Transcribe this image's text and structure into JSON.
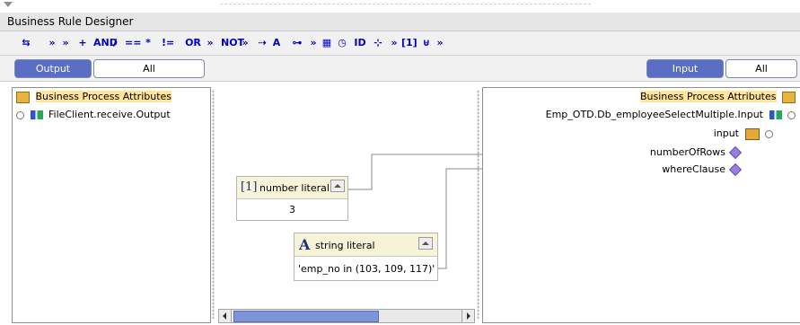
{
  "window": {
    "title": "Business Rule Designer"
  },
  "toolbar": {
    "items": [
      {
        "name": "select-tool-icon",
        "glyph": "⇆"
      },
      {
        "name": "more-icon-1",
        "glyph": "»"
      },
      {
        "name": "more-icon-2",
        "glyph": "»"
      },
      {
        "name": "add-icon",
        "glyph": "+"
      },
      {
        "name": "and-label",
        "glyph": "AND"
      },
      {
        "name": "divide-icon",
        "glyph": "/"
      },
      {
        "name": "equals-icon",
        "glyph": "=="
      },
      {
        "name": "multiply-icon",
        "glyph": "*"
      },
      {
        "name": "not-equal-icon",
        "glyph": "!="
      },
      {
        "name": "or-label",
        "glyph": "OR"
      },
      {
        "name": "more-icon-3",
        "glyph": "»"
      },
      {
        "name": "not-label",
        "glyph": "NOT"
      },
      {
        "name": "more-icon-4",
        "glyph": "»"
      },
      {
        "name": "switch-icon",
        "glyph": "⇢"
      },
      {
        "name": "string-icon",
        "glyph": "A"
      },
      {
        "name": "concat-icon",
        "glyph": "⊶"
      },
      {
        "name": "more-icon-5",
        "glyph": "»"
      },
      {
        "name": "calendar-icon",
        "glyph": "▦"
      },
      {
        "name": "clock-icon",
        "glyph": "◷"
      },
      {
        "name": "id-icon",
        "glyph": "ID"
      },
      {
        "name": "split-icon",
        "glyph": "⊹"
      },
      {
        "name": "more-icon-6",
        "glyph": "»"
      },
      {
        "name": "number-literal-icon",
        "glyph": "[1]"
      },
      {
        "name": "join-icon",
        "glyph": "⊎"
      },
      {
        "name": "more-icon-7",
        "glyph": "»"
      }
    ]
  },
  "left_tabs": {
    "output": "Output",
    "all": "All"
  },
  "right_tabs": {
    "input": "Input",
    "all": "All"
  },
  "left_tree": {
    "root": "Business Process Attributes",
    "child": "FileClient.receive.Output"
  },
  "right_tree": {
    "root": "Business Process Attributes",
    "child": "Emp_OTD.Db_employeeSelectMultiple.Input",
    "node": "input",
    "fields": [
      "numberOfRows",
      "whereClause"
    ]
  },
  "number_literal": {
    "icon": "[1]",
    "title": "number literal",
    "value": "3"
  },
  "string_literal": {
    "icon": "A",
    "title": "string literal",
    "value": "'emp_no in (103, 109, 117)'"
  },
  "colors": {
    "accent": "#5a6ec6",
    "highlight": "#ffe49a",
    "diamond": "#9a7ddc"
  }
}
